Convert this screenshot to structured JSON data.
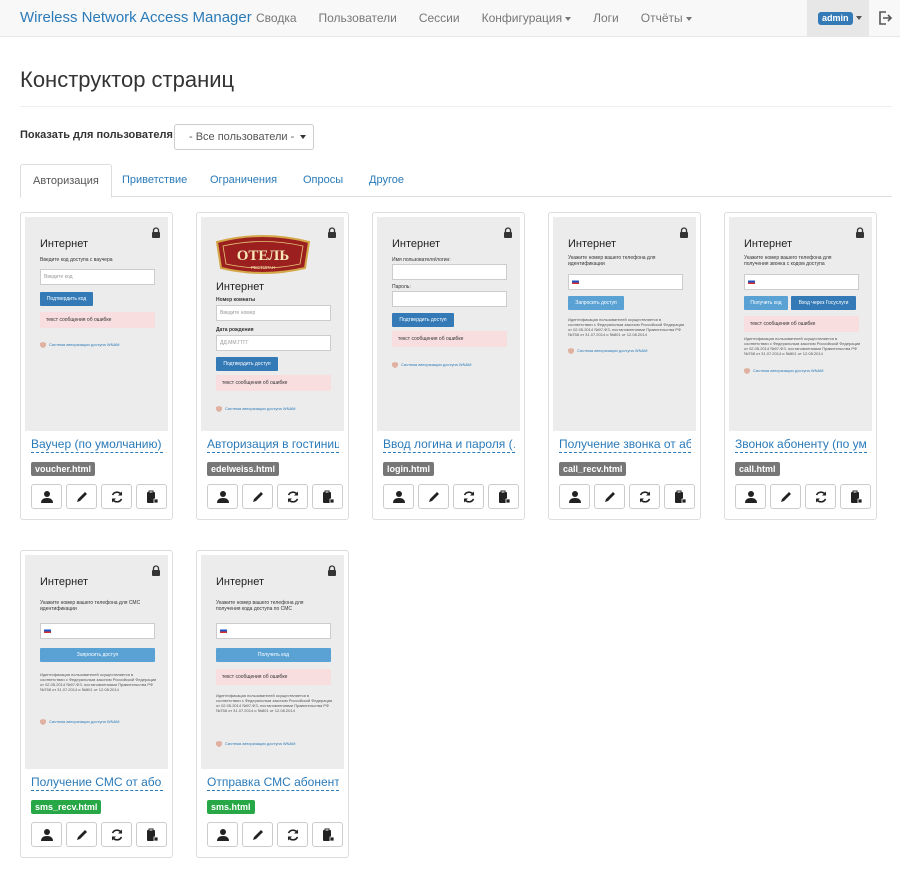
{
  "nav": {
    "brand": "Wireless Network Access Manager",
    "items": [
      {
        "label": "Сводка",
        "dropdown": false
      },
      {
        "label": "Пользователи",
        "dropdown": false
      },
      {
        "label": "Сессии",
        "dropdown": false
      },
      {
        "label": "Конфигурация",
        "dropdown": true
      },
      {
        "label": "Логи",
        "dropdown": false
      },
      {
        "label": "Отчёты",
        "dropdown": true
      }
    ],
    "user": "admin"
  },
  "page": {
    "title": "Конструктор страниц",
    "filter_label": "Показать для пользователя",
    "filter_value": "- Все пользователи -"
  },
  "tabs": [
    "Авторизация",
    "Приветствие",
    "Ограничения",
    "Опросы",
    "Другое"
  ],
  "active_tab": "Авторизация",
  "preview_common": {
    "heading": "Интернет",
    "error_text": "текст сообщения об ошибке",
    "footer_text": "Система авторизации доступа WNAM",
    "legal_text": "Идентификация пользователей осуществляется в соответствии с Федеральным законом Российской Федерации от 02.05.2014 №97-ФЗ, постановлениями Правительства РФ №758 от 31.07.2014 и №801 от 12.08.2014"
  },
  "cards": [
    {
      "title": "Ваучер (по умолчанию)",
      "file": "voucher.html",
      "badge": "gray",
      "preview": {
        "prompt": "Введите код доступа с ваучера",
        "placeholder": "Введите код",
        "button": "Подтвердить код"
      }
    },
    {
      "title": "Авторизация в гостиниц…",
      "file": "edelweiss.html",
      "badge": "gray",
      "preview": {
        "logo_text": "ОТЕЛЬ",
        "logo_sub": "РЕСТОРАН",
        "room_label": "Номер комнаты",
        "room_placeholder": "Введите номер",
        "date_label": "Дата рождения",
        "date_placeholder": "ДД.ММ.ГГГГ",
        "button": "Подтвердить доступ"
      }
    },
    {
      "title": "Ввод логина и пароля (…",
      "file": "login.html",
      "badge": "gray",
      "preview": {
        "login_label": "Имя пользователя/логин:",
        "password_label": "Пароль:",
        "button": "Подтвердить доступ"
      }
    },
    {
      "title": "Получение звонка от аб…",
      "file": "call_recv.html",
      "badge": "gray",
      "preview": {
        "prompt1": "Укажите номер вашего телефона для",
        "prompt2": "идентификации",
        "button": "Запросить доступ"
      }
    },
    {
      "title": "Звонок абоненту (по ум…",
      "file": "call.html",
      "badge": "gray",
      "preview": {
        "prompt1": "Укажите номер вашего телефона для",
        "prompt2": "получения звонка с кодом доступа",
        "button1": "Получить код",
        "button2": "Вход через Госуслуги"
      }
    },
    {
      "title": "Получение СМС от або…",
      "file": "sms_recv.html",
      "badge": "green",
      "preview": {
        "prompt1": "Укажите номер вашего телефона для СМС",
        "prompt2": "идентификации",
        "button": "Запросить доступ"
      }
    },
    {
      "title": "Отправка СМС абонент…",
      "file": "sms.html",
      "badge": "green",
      "preview": {
        "prompt1": "Укажите номер вашего телефона для",
        "prompt2": "получения кода доступа по СМС",
        "button": "Получить код"
      }
    }
  ],
  "actions": [
    "user-icon",
    "pencil-icon",
    "refresh-icon",
    "clipboard-icon"
  ],
  "colors": {
    "link": "#2a7ab8",
    "primary": "#337ab7",
    "badge_gray": "#777777",
    "badge_green": "#27a745",
    "error_bg": "#f8dede"
  }
}
